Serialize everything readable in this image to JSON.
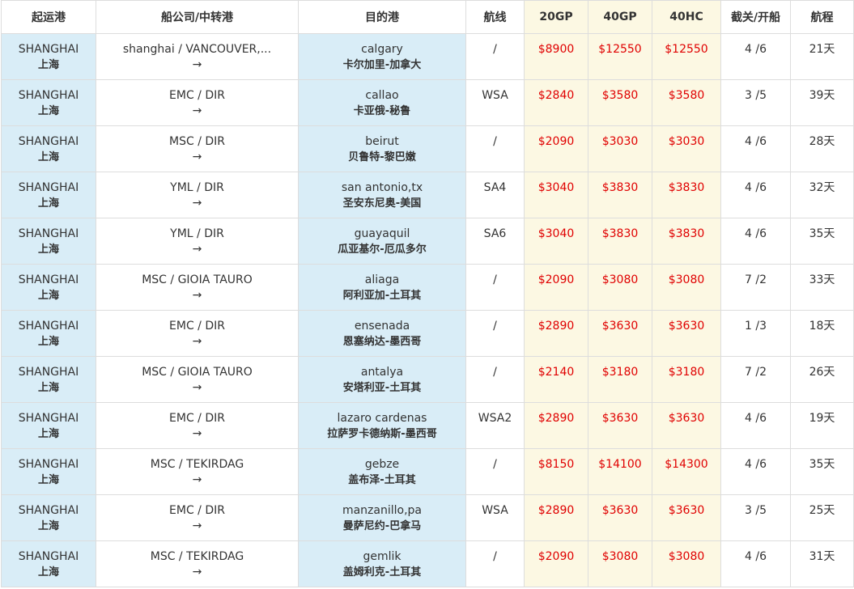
{
  "headers": {
    "origin": "起运港",
    "carrier": "船公司/中转港",
    "destination": "目的港",
    "route": "航线",
    "p20gp": "20GP",
    "p40gp": "40GP",
    "p40hc": "40HC",
    "cutoff": "截关/开船",
    "transit": "航程"
  },
  "arrow": "→",
  "rows": [
    {
      "origin_en": "SHANGHAI",
      "origin_cn": "上海",
      "carrier": "shanghai / VANCOUVER,...",
      "dest_en": "calgary",
      "dest_cn": "卡尔加里-加拿大",
      "route": "/",
      "p20gp": "$8900",
      "p40gp": "$12550",
      "p40hc": "$12550",
      "cutoff": "4 /6",
      "transit": "21天"
    },
    {
      "origin_en": "SHANGHAI",
      "origin_cn": "上海",
      "carrier": "EMC / DIR",
      "dest_en": "callao",
      "dest_cn": "卡亚俄-秘鲁",
      "route": "WSA",
      "p20gp": "$2840",
      "p40gp": "$3580",
      "p40hc": "$3580",
      "cutoff": "3 /5",
      "transit": "39天"
    },
    {
      "origin_en": "SHANGHAI",
      "origin_cn": "上海",
      "carrier": "MSC / DIR",
      "dest_en": "beirut",
      "dest_cn": "贝鲁特-黎巴嫩",
      "route": "/",
      "p20gp": "$2090",
      "p40gp": "$3030",
      "p40hc": "$3030",
      "cutoff": "4 /6",
      "transit": "28天"
    },
    {
      "origin_en": "SHANGHAI",
      "origin_cn": "上海",
      "carrier": "YML / DIR",
      "dest_en": "san antonio,tx",
      "dest_cn": "圣安东尼奥-美国",
      "route": "SA4",
      "p20gp": "$3040",
      "p40gp": "$3830",
      "p40hc": "$3830",
      "cutoff": "4 /6",
      "transit": "32天"
    },
    {
      "origin_en": "SHANGHAI",
      "origin_cn": "上海",
      "carrier": "YML / DIR",
      "dest_en": "guayaquil",
      "dest_cn": "瓜亚基尔-厄瓜多尔",
      "route": "SA6",
      "p20gp": "$3040",
      "p40gp": "$3830",
      "p40hc": "$3830",
      "cutoff": "4 /6",
      "transit": "35天"
    },
    {
      "origin_en": "SHANGHAI",
      "origin_cn": "上海",
      "carrier": "MSC / GIOIA TAURO",
      "dest_en": "aliaga",
      "dest_cn": "阿利亚加-土耳其",
      "route": "/",
      "p20gp": "$2090",
      "p40gp": "$3080",
      "p40hc": "$3080",
      "cutoff": "7 /2",
      "transit": "33天"
    },
    {
      "origin_en": "SHANGHAI",
      "origin_cn": "上海",
      "carrier": "EMC / DIR",
      "dest_en": "ensenada",
      "dest_cn": "恩塞纳达-墨西哥",
      "route": "/",
      "p20gp": "$2890",
      "p40gp": "$3630",
      "p40hc": "$3630",
      "cutoff": "1 /3",
      "transit": "18天"
    },
    {
      "origin_en": "SHANGHAI",
      "origin_cn": "上海",
      "carrier": "MSC / GIOIA TAURO",
      "dest_en": "antalya",
      "dest_cn": "安塔利亚-土耳其",
      "route": "/",
      "p20gp": "$2140",
      "p40gp": "$3180",
      "p40hc": "$3180",
      "cutoff": "7 /2",
      "transit": "26天"
    },
    {
      "origin_en": "SHANGHAI",
      "origin_cn": "上海",
      "carrier": "EMC / DIR",
      "dest_en": "lazaro cardenas",
      "dest_cn": "拉萨罗卡德纳斯-墨西哥",
      "route": "WSA2",
      "p20gp": "$2890",
      "p40gp": "$3630",
      "p40hc": "$3630",
      "cutoff": "4 /6",
      "transit": "19天"
    },
    {
      "origin_en": "SHANGHAI",
      "origin_cn": "上海",
      "carrier": "MSC / TEKIRDAG",
      "dest_en": "gebze",
      "dest_cn": "盖布泽-土耳其",
      "route": "/",
      "p20gp": "$8150",
      "p40gp": "$14100",
      "p40hc": "$14300",
      "cutoff": "4 /6",
      "transit": "35天"
    },
    {
      "origin_en": "SHANGHAI",
      "origin_cn": "上海",
      "carrier": "EMC / DIR",
      "dest_en": "manzanillo,pa",
      "dest_cn": "曼萨尼约-巴拿马",
      "route": "WSA",
      "p20gp": "$2890",
      "p40gp": "$3630",
      "p40hc": "$3630",
      "cutoff": "3 /5",
      "transit": "25天"
    },
    {
      "origin_en": "SHANGHAI",
      "origin_cn": "上海",
      "carrier": "MSC / TEKIRDAG",
      "dest_en": "gemlik",
      "dest_cn": "盖姆利克-土耳其",
      "route": "/",
      "p20gp": "$2090",
      "p40gp": "$3080",
      "p40hc": "$3080",
      "cutoff": "4 /6",
      "transit": "31天"
    }
  ]
}
